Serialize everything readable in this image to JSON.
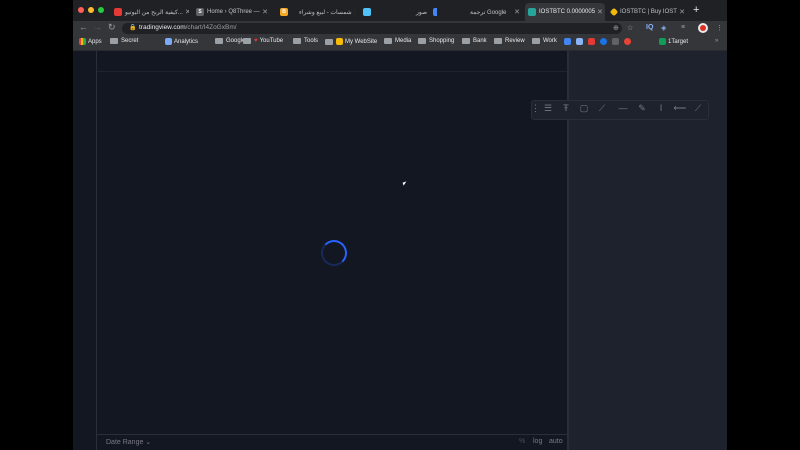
{
  "tabs": [
    {
      "title": "كيفية الربح من اليوتيو...",
      "favicon_color": "#e53935"
    },
    {
      "title": "Home › Q8Three —",
      "favicon_color": "#5f6368"
    },
    {
      "title": "شمسات - لبيع وشراء",
      "favicon_color": "#f9a825"
    },
    {
      "title": "",
      "favicon_color": "#4fc3f7"
    },
    {
      "title": "صور",
      "favicon_color": "#4285f4"
    },
    {
      "title": "ترجمة Google",
      "favicon_color": "#4285f4"
    },
    {
      "title": "IOSTBTC 0.0000005",
      "favicon_color": "#26a69a"
    },
    {
      "title": "IOSTBTC | Buy IOST",
      "favicon_color": "#f0b90b"
    }
  ],
  "toolbar": {
    "url_host": "tradingview.com",
    "url_path": "/chart/I4ZoGxBm/"
  },
  "bookmarks": [
    {
      "label": "Apps",
      "type": "apps"
    },
    {
      "label": "Secret",
      "type": "folder"
    },
    {
      "label": "Analytics",
      "type": "site"
    },
    {
      "label": "Google",
      "type": "folder"
    },
    {
      "label": "YouTube",
      "type": "folder"
    },
    {
      "label": "Tools",
      "type": "folder"
    },
    {
      "label": "My WebSite",
      "type": "folder"
    },
    {
      "label": "Media",
      "type": "folder"
    },
    {
      "label": "Shopping",
      "type": "folder"
    },
    {
      "label": "Bank",
      "type": "folder"
    },
    {
      "label": "Review",
      "type": "folder"
    },
    {
      "label": "Work",
      "type": "folder"
    },
    {
      "label": "1Target",
      "type": "site"
    }
  ],
  "chart_footer": {
    "date_range": "Date Range",
    "log": "log",
    "auto": "auto"
  },
  "toolbar_icons": {
    "extension_iq": "IQ"
  }
}
